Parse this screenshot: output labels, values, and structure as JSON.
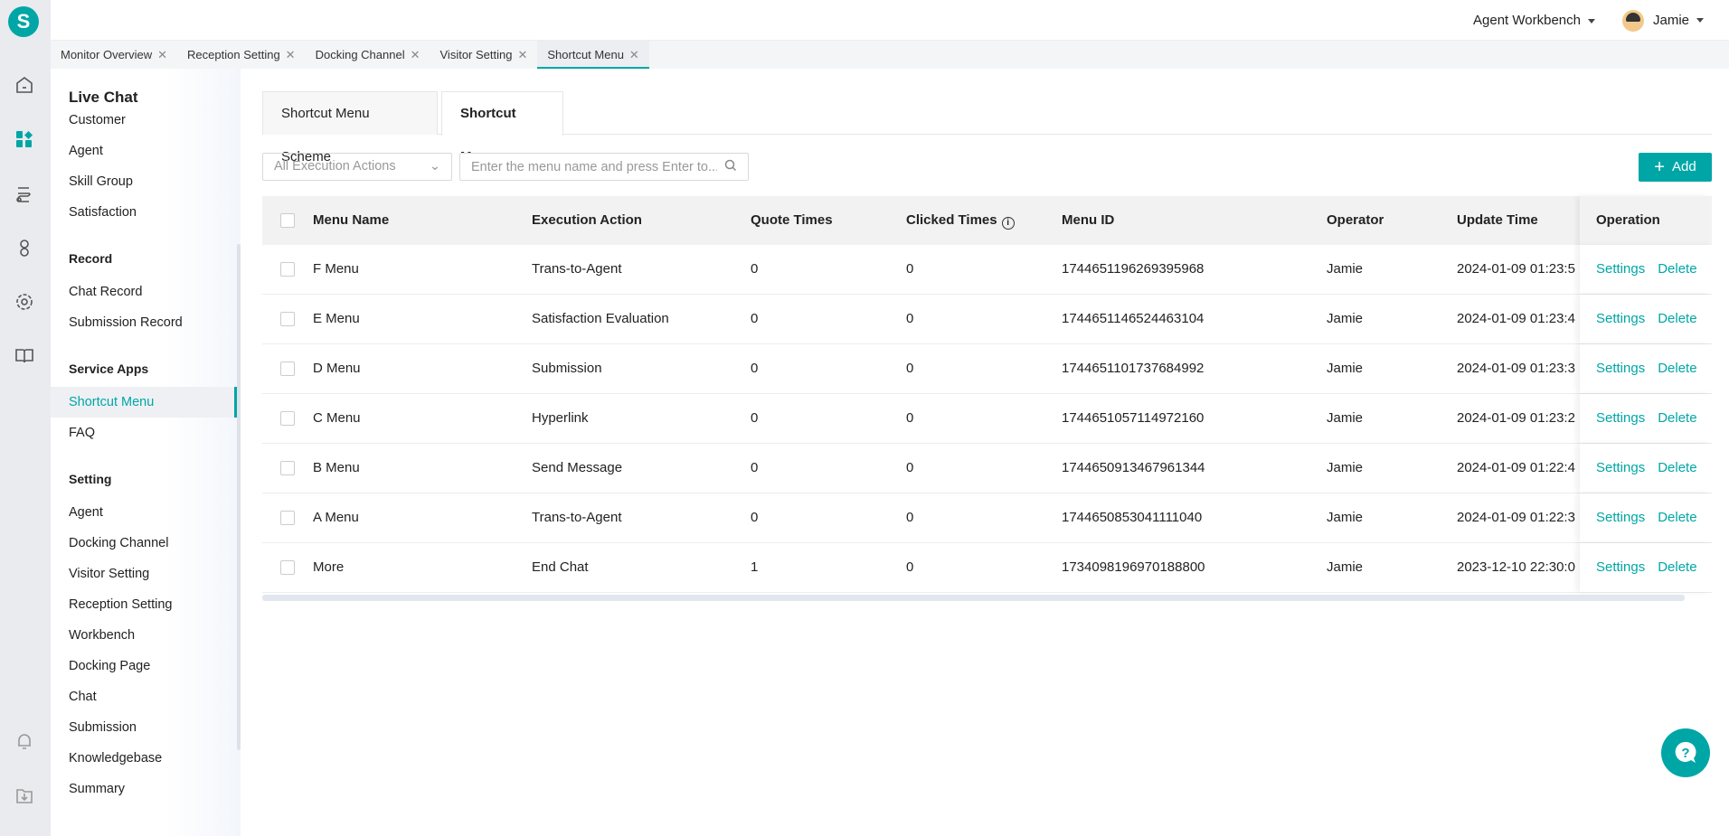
{
  "app": {
    "logo_letter": "S",
    "accent": "#00a6a6"
  },
  "header": {
    "workbench": "Agent Workbench",
    "user": "Jamie"
  },
  "page_tabs": [
    {
      "label": "Monitor Overview"
    },
    {
      "label": "Reception Setting"
    },
    {
      "label": "Docking Channel"
    },
    {
      "label": "Visitor Setting"
    },
    {
      "label": "Shortcut Menu",
      "active": true
    }
  ],
  "rail_icons": [
    "home-icon",
    "apps-icon",
    "route-icon",
    "user-icon",
    "gear-icon",
    "book-icon",
    "bell-icon",
    "download-icon"
  ],
  "sidebar": {
    "title": "Live Chat",
    "items": [
      "Customer",
      "Agent",
      "Skill Group",
      "Satisfaction"
    ],
    "groups": [
      {
        "label": "Record",
        "items": [
          "Chat Record",
          "Submission Record"
        ]
      },
      {
        "label": "Service Apps",
        "items": [
          "Shortcut Menu",
          "FAQ"
        ]
      },
      {
        "label": "Setting",
        "items": [
          "Agent",
          "Docking Channel",
          "Visitor Setting",
          "Reception Setting",
          "Workbench",
          "Docking Page",
          "Chat",
          "Submission",
          "Knowledgebase",
          "Summary"
        ]
      }
    ],
    "active": "Shortcut Menu"
  },
  "inner_tabs": {
    "scheme": "Shortcut Menu Scheme",
    "menu": "Shortcut Menu"
  },
  "filters": {
    "select_value": "All Execution Actions",
    "search_placeholder": "Enter the menu name and press Enter to...",
    "add_label": "Add"
  },
  "table": {
    "headers": [
      "Menu Name",
      "Execution Action",
      "Quote Times",
      "Clicked Times",
      "Menu ID",
      "Operator",
      "Update Time",
      "Operation"
    ],
    "rows": [
      [
        "F Menu",
        "Trans-to-Agent",
        "0",
        "0",
        "1744651196269395968",
        "Jamie",
        "2024-01-09 01:23:5"
      ],
      [
        "E Menu",
        "Satisfaction Evaluation",
        "0",
        "0",
        "1744651146524463104",
        "Jamie",
        "2024-01-09 01:23:4"
      ],
      [
        "D Menu",
        "Submission",
        "0",
        "0",
        "1744651101737684992",
        "Jamie",
        "2024-01-09 01:23:3"
      ],
      [
        "C Menu",
        "Hyperlink",
        "0",
        "0",
        "1744651057114972160",
        "Jamie",
        "2024-01-09 01:23:2"
      ],
      [
        "B Menu",
        "Send Message",
        "0",
        "0",
        "1744650913467961344",
        "Jamie",
        "2024-01-09 01:22:4"
      ],
      [
        "A Menu",
        "Trans-to-Agent",
        "0",
        "0",
        "1744650853041111040",
        "Jamie",
        "2024-01-09 01:22:3"
      ],
      [
        "More",
        "End Chat",
        "1",
        "0",
        "1734098196970188800",
        "Jamie",
        "2023-12-10 22:30:0"
      ]
    ],
    "settings_label": "Settings",
    "delete_label": "Delete"
  }
}
